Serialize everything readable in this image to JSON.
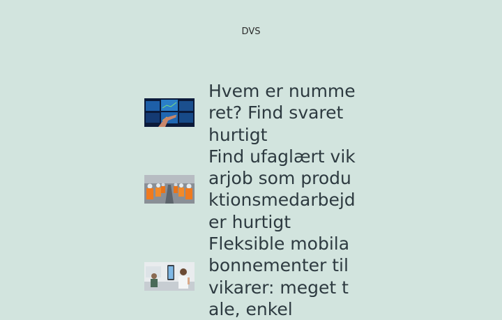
{
  "site": {
    "title": "DVS"
  },
  "articles": [
    {
      "headline": "Hvem er nummeret? Find svaret hurtigt",
      "image_icon": "trading-screens-image"
    },
    {
      "headline": "Find ufaglært vikarjob som produktionsmedarbejder hurtigt",
      "image_icon": "factory-workers-image"
    },
    {
      "headline": "Fleksible mobilabonnementer til vikarer: meget tale, enkel",
      "image_icon": "woman-phone-image"
    }
  ]
}
